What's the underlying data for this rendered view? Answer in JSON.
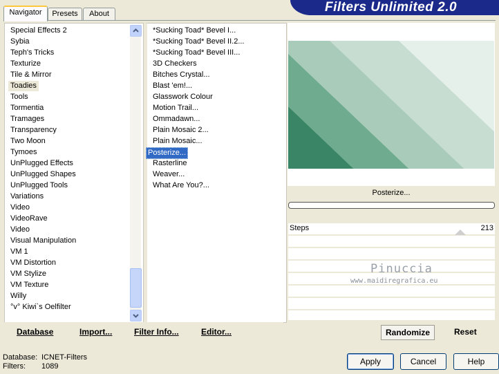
{
  "app": {
    "title": "Filters Unlimited 2.0"
  },
  "tabs": [
    {
      "label": "Navigator"
    },
    {
      "label": "Presets"
    },
    {
      "label": "About"
    }
  ],
  "categories": [
    "Special Effects 2",
    "Sybia",
    "Teph's Tricks",
    "Texturize",
    "Tile & Mirror",
    "Toadies",
    "Tools",
    "Tormentia",
    "Tramages",
    "Transparency",
    "Two Moon",
    "Tymoes",
    "UnPlugged Effects",
    "UnPlugged Shapes",
    "UnPlugged Tools",
    "Variations",
    "Video",
    "VideoRave",
    "Video",
    "Visual Manipulation",
    "VM 1",
    "VM Distortion",
    "VM Stylize",
    "VM Texture",
    "Willy",
    "°v° Kiwi`s Oelfilter"
  ],
  "selected_category": "Toadies",
  "filters": [
    "*Sucking Toad*  Bevel I...",
    "*Sucking Toad*  Bevel II.2...",
    "*Sucking Toad*  Bevel III...",
    "3D Checkers",
    "Bitches Crystal...",
    "Blast 'em!...",
    "Glasswork Colour",
    "Motion Trail...",
    "Ommadawn...",
    "Plain Mosaic 2...",
    "Plain Mosaic...",
    "Posterize...",
    "Rasterline",
    "Weaver...",
    "What Are You?..."
  ],
  "selected_filter": "Posterize...",
  "preview": {
    "filter_name": "Posterize...",
    "colors": [
      "#3a8566",
      "#6fab8f",
      "#a8cbba",
      "#c7ddd2",
      "#e6f0eb"
    ]
  },
  "params": [
    {
      "label": "Steps",
      "value": "213"
    }
  ],
  "watermark": {
    "name": "Pinuccia",
    "url": "www.maidiregrafica.eu"
  },
  "left_footer": {
    "database": "Database",
    "import": "Import...",
    "filter_info": "Filter Info...",
    "editor": "Editor..."
  },
  "right_footer": {
    "randomize": "Randomize",
    "reset": "Reset"
  },
  "status": {
    "database_label": "Database:",
    "database_value": "ICNET-Filters",
    "filters_label": "Filters:",
    "filters_value": "1089"
  },
  "buttons": {
    "apply": "Apply",
    "cancel": "Cancel",
    "help": "Help"
  }
}
